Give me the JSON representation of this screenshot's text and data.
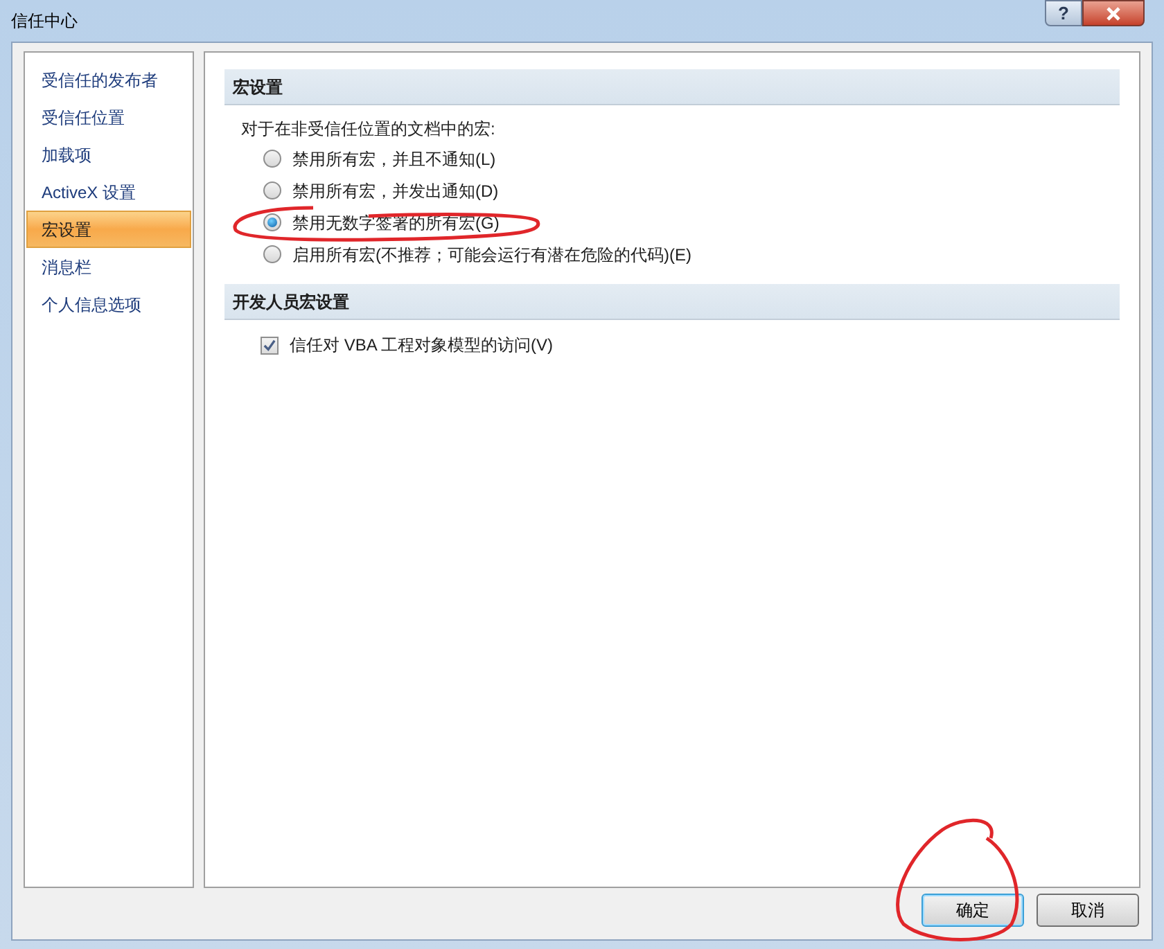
{
  "window": {
    "title": "信任中心",
    "help": "?"
  },
  "sidebar": {
    "items": [
      {
        "label": "受信任的发布者",
        "selected": false
      },
      {
        "label": "受信任位置",
        "selected": false
      },
      {
        "label": "加载项",
        "selected": false
      },
      {
        "label": "ActiveX 设置",
        "selected": false
      },
      {
        "label": "宏设置",
        "selected": true
      },
      {
        "label": "消息栏",
        "selected": false
      },
      {
        "label": "个人信息选项",
        "selected": false
      }
    ]
  },
  "sections": [
    {
      "title": "宏设置",
      "description": "对于在非受信任位置的文档中的宏:",
      "options": [
        {
          "kind": "radio",
          "label": "禁用所有宏，并且不通知(L)",
          "selected": false
        },
        {
          "kind": "radio",
          "label": "禁用所有宏，并发出通知(D)",
          "selected": false
        },
        {
          "kind": "radio",
          "label": "禁用无数字签署的所有宏(G)",
          "selected": true
        },
        {
          "kind": "radio",
          "label": "启用所有宏(不推荐；可能会运行有潜在危险的代码)(E)",
          "selected": false
        }
      ]
    },
    {
      "title": "开发人员宏设置",
      "options": [
        {
          "kind": "checkbox",
          "label": "信任对 VBA 工程对象模型的访问(V)",
          "checked": true
        }
      ]
    }
  ],
  "buttons": [
    {
      "label": "确定",
      "default": true
    },
    {
      "label": "取消",
      "default": false
    }
  ]
}
